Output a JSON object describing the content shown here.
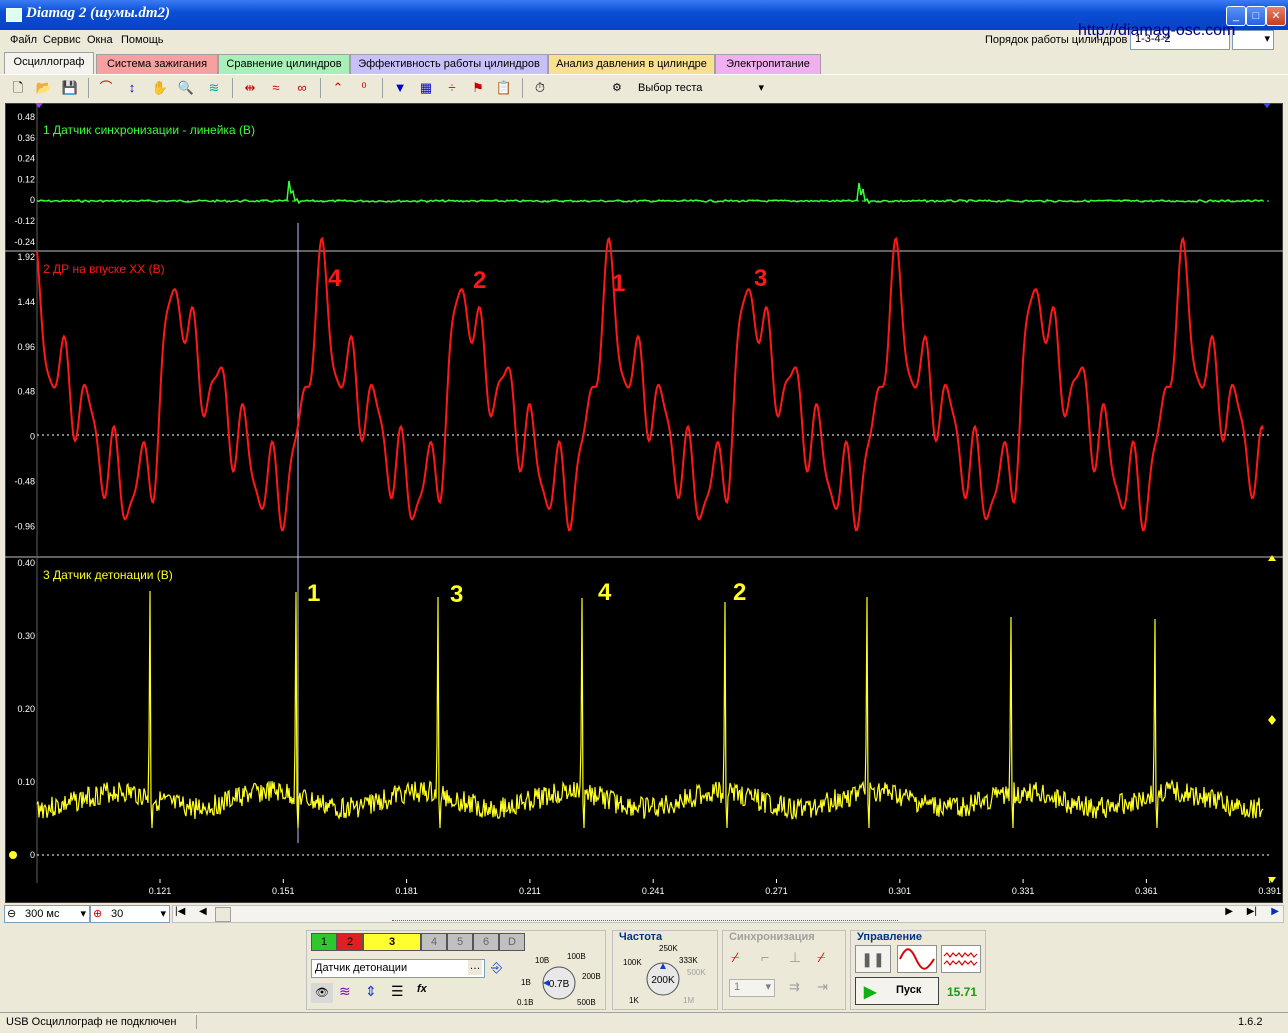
{
  "window": {
    "title": "Diamag 2 (шумы.dm2)",
    "url_overlay": "http://diamag-osc.com"
  },
  "menu": [
    "Файл",
    "Сервис",
    "Окна",
    "Помощь"
  ],
  "cylinder_order": {
    "label": "Порядок работы цилиндров",
    "value": "1-3-4-2"
  },
  "tabs": [
    {
      "label": "Осциллограф",
      "color": "#f4f3ee"
    },
    {
      "label": "Система зажигания",
      "color": "#f7a0a0"
    },
    {
      "label": "Сравнение цилиндров",
      "color": "#a8f0b8"
    },
    {
      "label": "Эффективность работы цилиндров",
      "color": "#c8c0f8"
    },
    {
      "label": "Анализ давления в цилиндре",
      "color": "#f8e090"
    },
    {
      "label": "Электропитание",
      "color": "#f0b0f0"
    }
  ],
  "toolbar": {
    "test_select": "Выбор теста"
  },
  "channels": [
    {
      "name": "1 Датчик синхронизации - линейка (В)",
      "color": "#39ff3a",
      "ticks": [
        "0.48",
        "0.36",
        "0.24",
        "0.12",
        "0",
        "-0.12",
        "-0.24"
      ]
    },
    {
      "name": "2 ДР на впуске ХХ (В)",
      "color": "#ff1818",
      "ticks": [
        "1.92",
        "1.44",
        "0.96",
        "0.48",
        "0",
        "-0.48",
        "-0.96"
      ]
    },
    {
      "name": "3 Датчик детонации (В)",
      "color": "#ffff20",
      "ticks": [
        "0.40",
        "0.30",
        "0.20",
        "0.10",
        "0"
      ]
    }
  ],
  "annotations": {
    "red": [
      "4",
      "2",
      "1",
      "3"
    ],
    "yellow": [
      "1",
      "3",
      "4",
      "2"
    ]
  },
  "time_axis": [
    "0.121",
    "0.151",
    "0.181",
    "0.211",
    "0.241",
    "0.271",
    "0.301",
    "0.331",
    "0.361",
    "0.391"
  ],
  "scale": {
    "timebase": "300 мс",
    "zoom": "30"
  },
  "channel_buttons": [
    "1",
    "2",
    "3",
    "4",
    "5",
    "6",
    "D"
  ],
  "channel_input": "Датчик детонации",
  "voltage": {
    "labels": [
      "10В",
      "100В",
      "200В",
      "500В",
      "0.1В",
      "1В"
    ],
    "value": "0.7В"
  },
  "frequency": {
    "title": "Частота",
    "labels": [
      "250K",
      "333K",
      "500K",
      "1M",
      "1K",
      "100K"
    ],
    "value": "200K"
  },
  "sync": {
    "title": "Синхронизация",
    "channel": "1"
  },
  "control": {
    "title": "Управление",
    "start": "Пуск",
    "value": "15.71"
  },
  "status": {
    "text": "USB Осциллограф не подключен",
    "version": "1.6.2"
  }
}
